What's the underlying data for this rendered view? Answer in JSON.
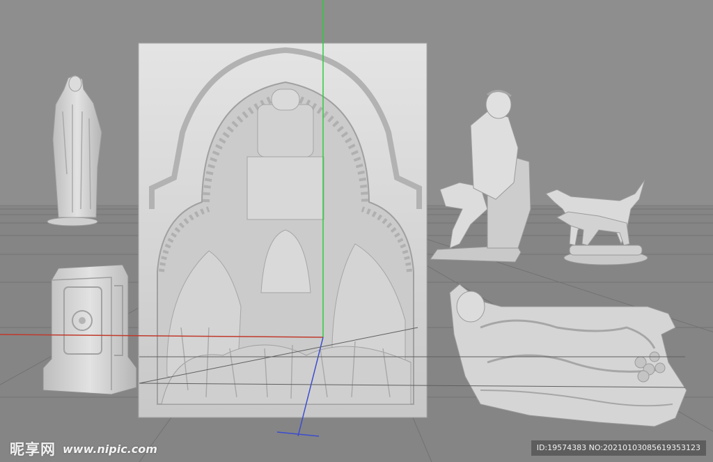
{
  "scene": {
    "description_visible": false,
    "background_color": "#8e8e8e",
    "floor_color": "#838383",
    "grid_color": "#6e6e6e",
    "axis_colors": {
      "x": "#c0392b",
      "y": "#2ecc40",
      "z": "#3b4ccf"
    },
    "sculpture_color": "#d6d6d6"
  },
  "watermark": {
    "logo_text": "昵享网",
    "url_text": "www.nipic.com",
    "id_text": "ID:19574383 NO:20210103085619353123"
  }
}
